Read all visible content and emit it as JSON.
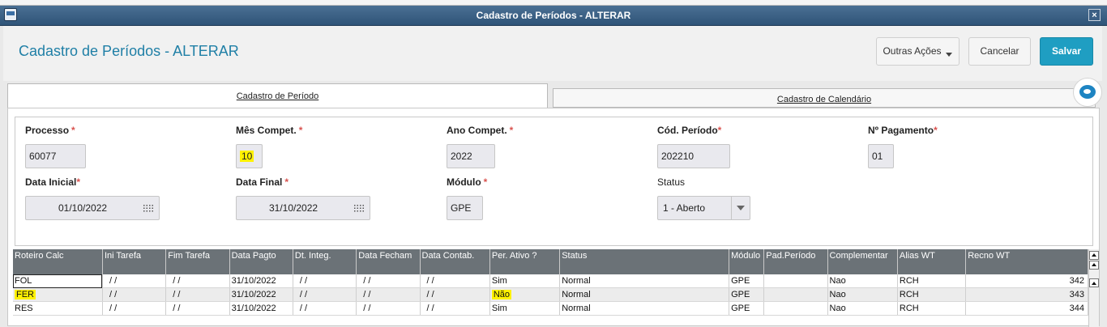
{
  "window": {
    "title": "Cadastro de Períodos - ALTERAR"
  },
  "header": {
    "title": "Cadastro de Períodos - ALTERAR",
    "outras_acoes": "Outras Ações",
    "cancelar": "Cancelar",
    "salvar": "Salvar"
  },
  "tabs": [
    {
      "label": "Cadastro de Período",
      "active": true
    },
    {
      "label": "Cadastro de Calendário",
      "active": false
    }
  ],
  "form": {
    "processo": {
      "label": "Processo",
      "value": "60077"
    },
    "mes_compet": {
      "label": "Mês Compet.",
      "value": "10"
    },
    "ano_compet": {
      "label": "Ano Compet.",
      "value": "2022"
    },
    "cod_periodo": {
      "label": "Cód. Período",
      "value": "202210"
    },
    "n_pagamento": {
      "label": "Nº Pagamento",
      "value": "01"
    },
    "data_inicial": {
      "label": "Data Inicial",
      "value": "01/10/2022"
    },
    "data_final": {
      "label": "Data Final",
      "value": "31/10/2022"
    },
    "modulo": {
      "label": "Módulo",
      "value": "GPE"
    },
    "status": {
      "label": "Status",
      "value": "1 - Aberto"
    }
  },
  "grid": {
    "columns": [
      "Roteiro Calc",
      "Ini Tarefa",
      "Fim Tarefa",
      "Data Pagto",
      "Dt. Integ.",
      "Data Fecham",
      "Data Contab.",
      "Per. Ativo ?",
      "Status",
      "Módulo",
      "Pad.Período",
      "Complementar",
      "Alias WT",
      "Recno WT"
    ],
    "rows": [
      [
        "FOL",
        "/ /",
        "/ /",
        "31/10/2022",
        "/ /",
        "/ /",
        "/ /",
        "Sim",
        "Normal",
        "GPE",
        "",
        "Nao",
        "RCH",
        "342"
      ],
      [
        "FER",
        "/ /",
        "/ /",
        "31/10/2022",
        "/ /",
        "/ /",
        "/ /",
        "Não",
        "Normal",
        "GPE",
        "",
        "Nao",
        "RCH",
        "343"
      ],
      [
        "RES",
        "/ /",
        "/ /",
        "31/10/2022",
        "/ /",
        "/ /",
        "/ /",
        "Sim",
        "Normal",
        "GPE",
        "",
        "Nao",
        "RCH",
        "344"
      ]
    ]
  },
  "colors": {
    "accent": "#1f9ec2",
    "title": "#1f7fa6",
    "highlight": "#fff200",
    "grid_header": "#6b7277"
  }
}
